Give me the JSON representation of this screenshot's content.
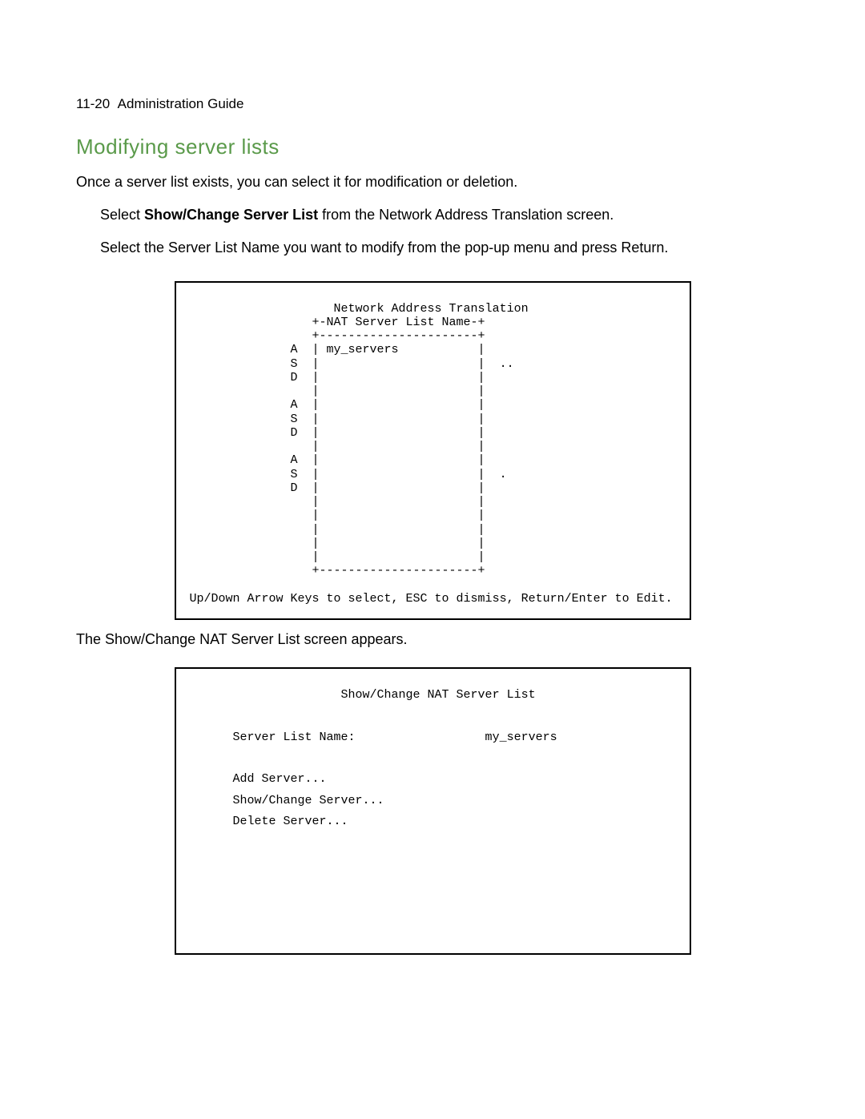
{
  "header": {
    "page_ref": "11-20",
    "doc_title": "Administration Guide"
  },
  "section": {
    "title": "Modifying server lists",
    "intro": "Once a server list exists, you can select it for modification or deletion.",
    "step1_pre": "Select ",
    "step1_bold": "Show/Change Server List",
    "step1_post": " from the Network Address Translation screen.",
    "step2": "Select the Server List Name you want to modify from the pop-up menu and press Return.",
    "after_box1": "The Show/Change NAT Server List screen appears."
  },
  "terminal1": {
    "content": "                     Network Address Translation\n                  +-NAT Server List Name-+\n                  +----------------------+\n               A  | my_servers           |\n               S  |                      |  ..\n               D  |                      |\n                  |                      |\n               A  |                      |\n               S  |                      |\n               D  |                      |\n                  |                      |\n               A  |                      |\n               S  |                      |  .\n               D  |                      |\n                  |                      |\n                  |                      |\n                  |                      |\n                  |                      |\n                  |                      |\n                  +----------------------+\n\n Up/Down Arrow Keys to select, ESC to dismiss, Return/Enter to Edit."
  },
  "terminal2": {
    "content": "                      Show/Change NAT Server List\n\n       Server List Name:                  my_servers\n\n       Add Server...\n       Show/Change Server...\n       Delete Server...\n\n\n\n\n\n"
  }
}
